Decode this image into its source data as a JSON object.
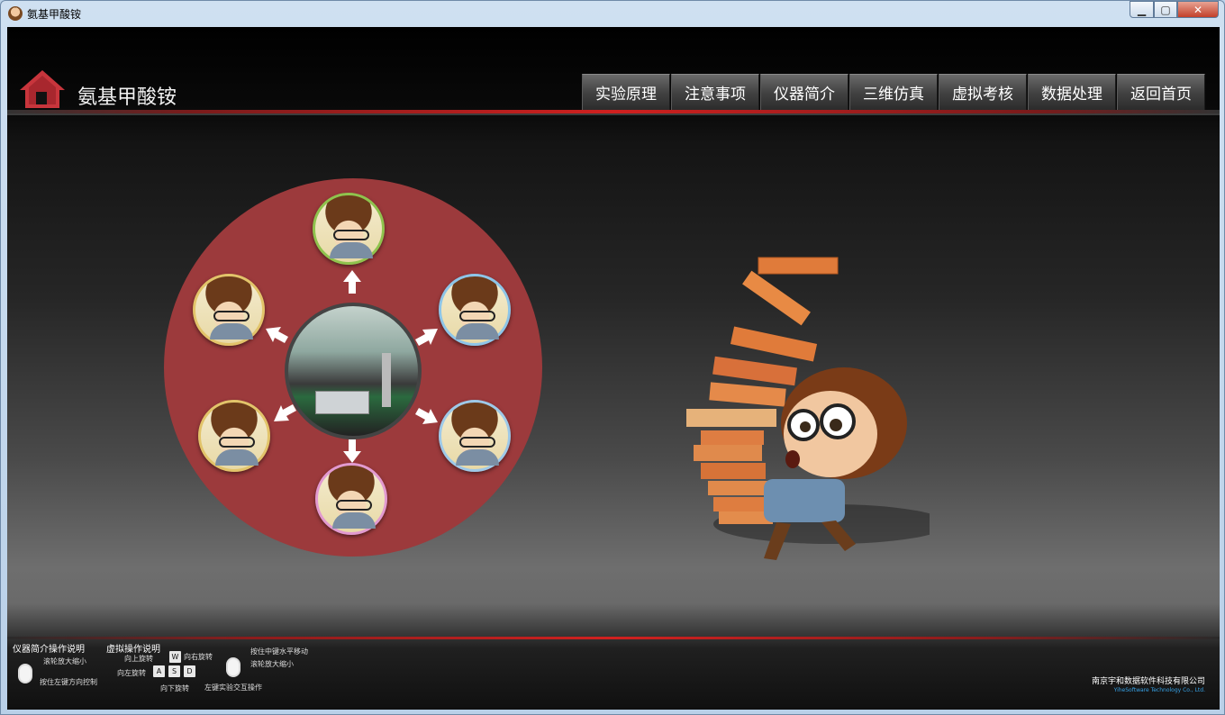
{
  "window": {
    "title": "氨基甲酸铵",
    "controls": {
      "minimize": "▁",
      "maximize": "▢",
      "close": "✕"
    }
  },
  "header": {
    "title": "氨基甲酸铵",
    "home_icon": "home-icon"
  },
  "nav": [
    {
      "label": "实验原理"
    },
    {
      "label": "注意事项"
    },
    {
      "label": "仪器简介"
    },
    {
      "label": "三维仿真"
    },
    {
      "label": "虚拟考核"
    },
    {
      "label": "数据处理"
    },
    {
      "label": "返回首页"
    }
  ],
  "footer": {
    "instrument": {
      "heading": "仪器简介操作说明",
      "scroll": "滚轮放大缩小",
      "left_drag": "按住左键方向控制"
    },
    "virtual": {
      "heading": "虚拟操作说明",
      "up": "向上旋转",
      "right": "向右旋转",
      "left": "向左旋转",
      "down": "向下旋转",
      "keys": [
        "W",
        "A",
        "S",
        "D"
      ],
      "middle_drag": "按住中键水平移动",
      "scroll": "滚轮放大缩小",
      "left_click": "左键实验交互操作"
    },
    "company_cn": "南京宇和数据软件科技有限公司",
    "company_en": "YiheSoftware Technology Co., Ltd."
  },
  "colors": {
    "accent_red": "#d0201f",
    "wheel": "#9c3a3c"
  }
}
